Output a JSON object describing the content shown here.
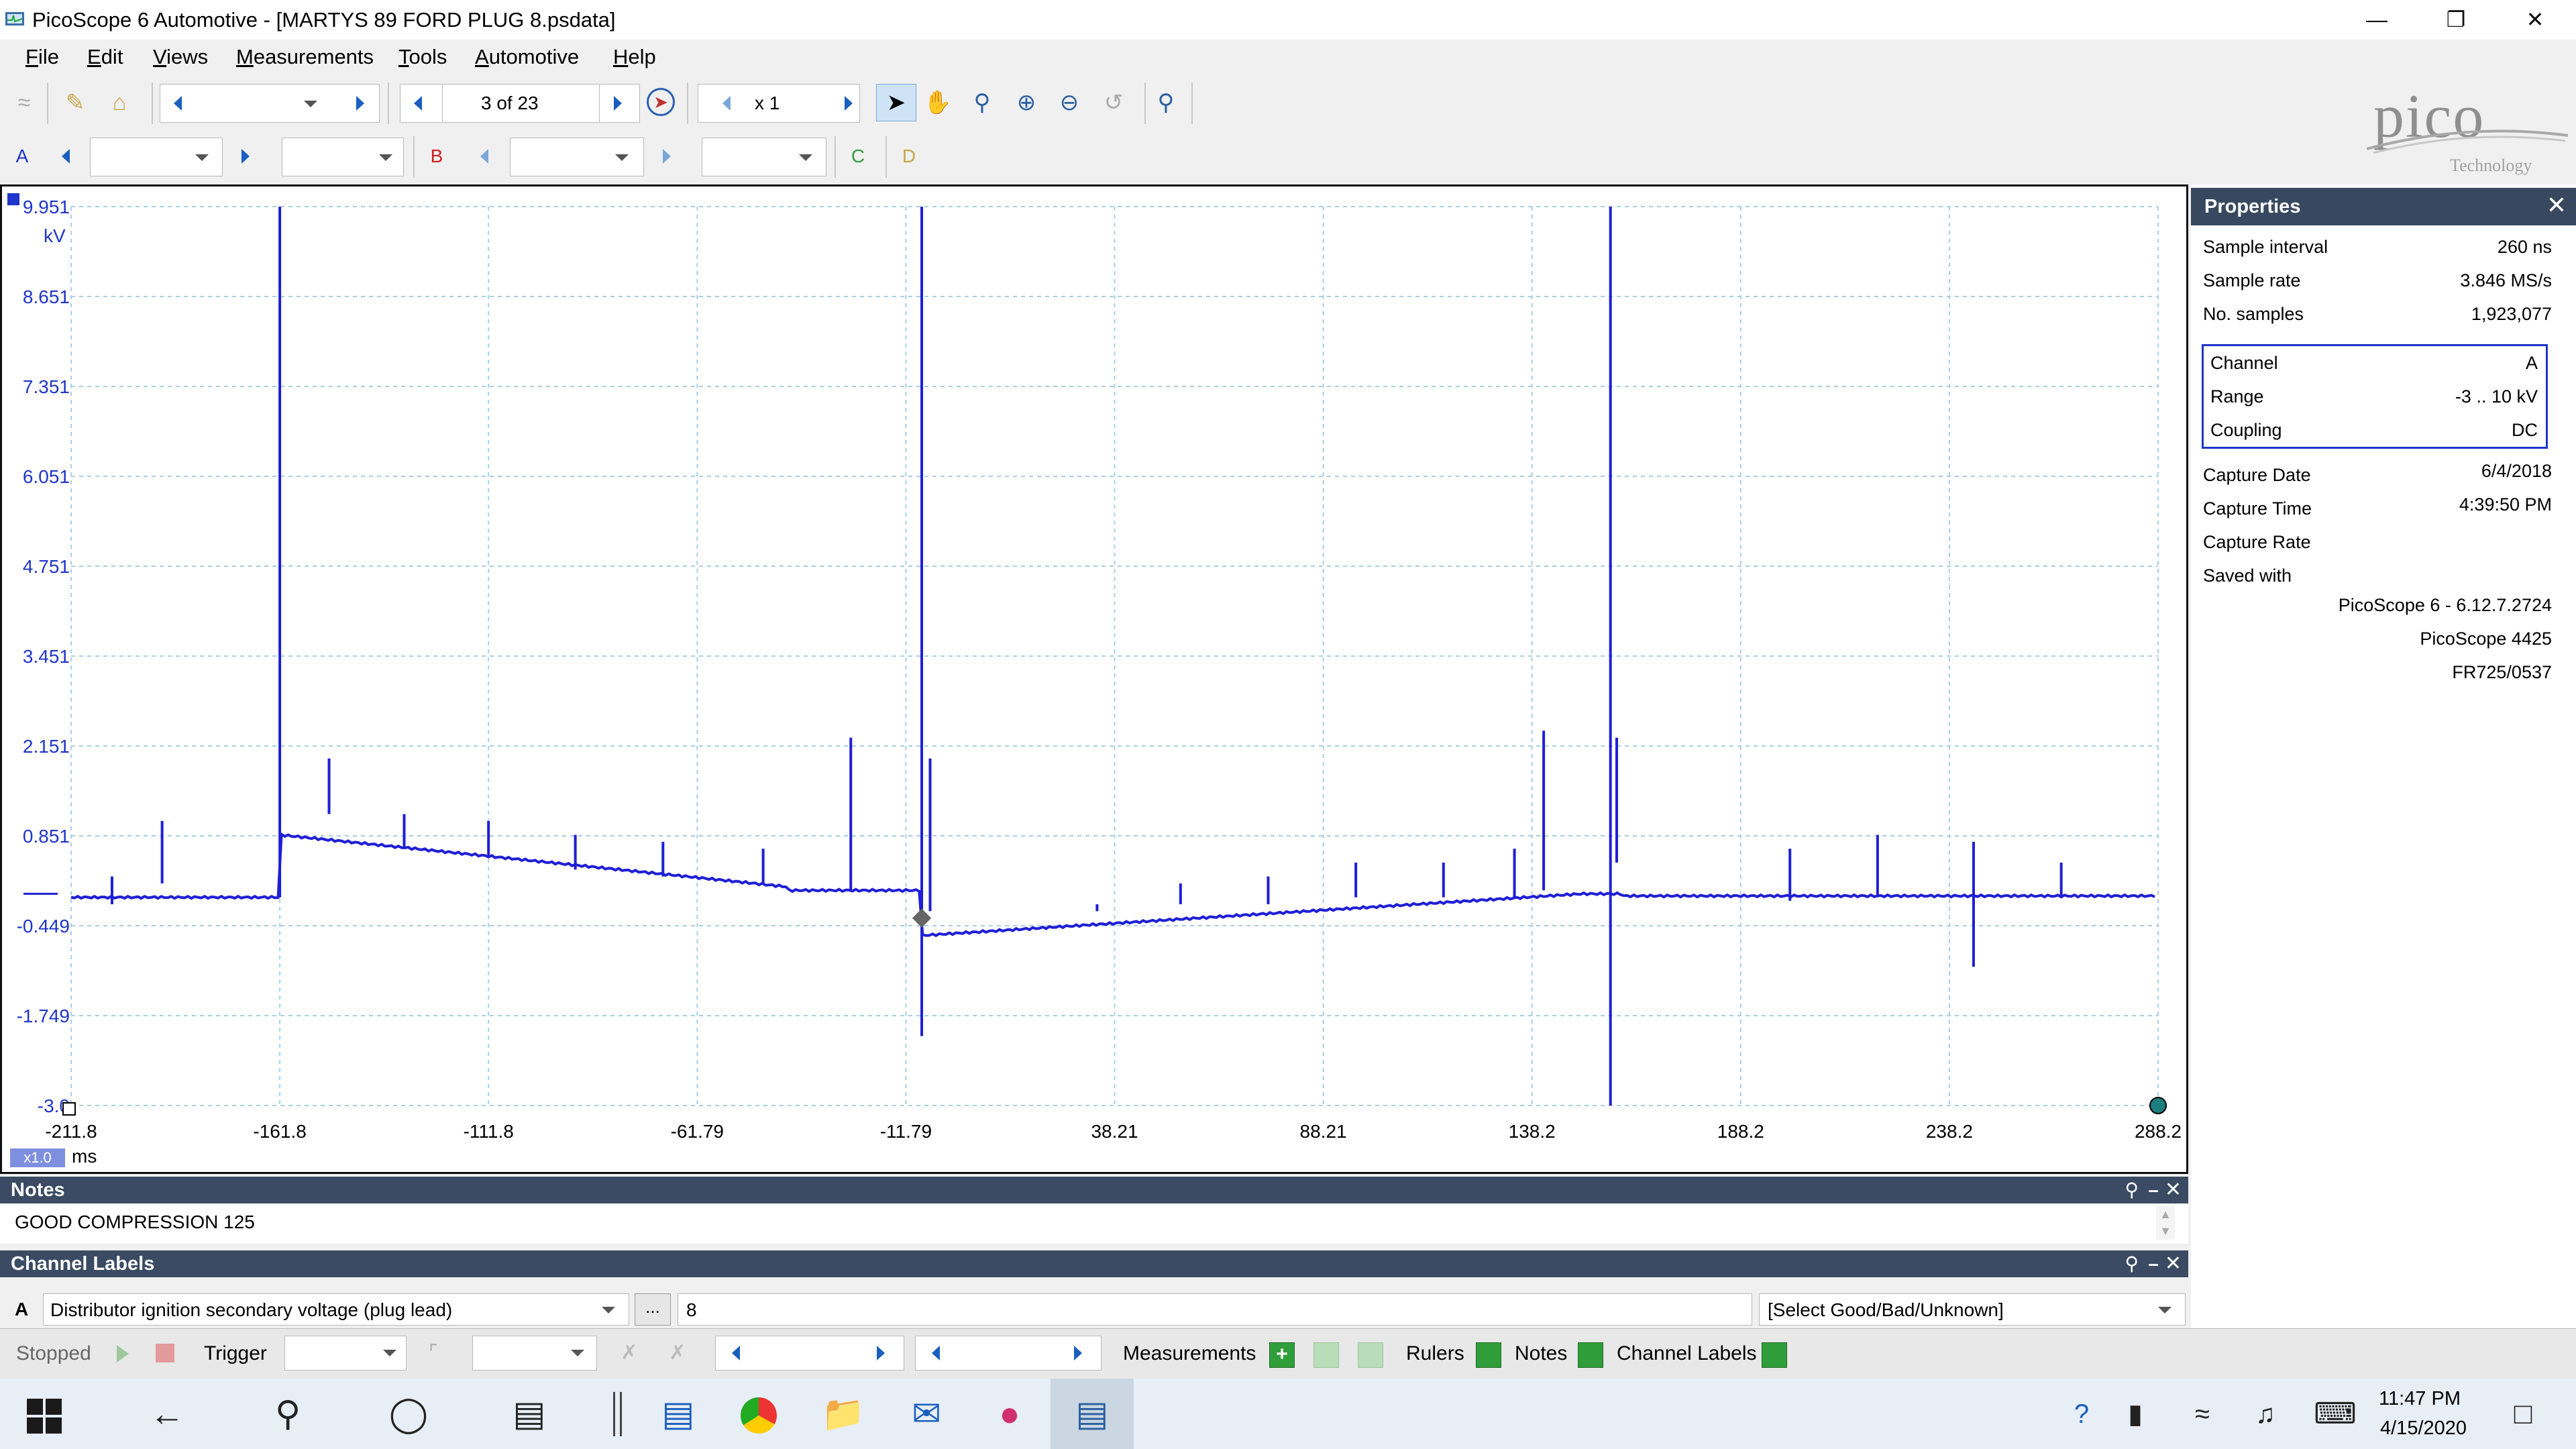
{
  "window": {
    "title": "PicoScope 6 Automotive - [MARTYS 89 FORD PLUG 8.psdata]"
  },
  "menu": [
    {
      "key": "F",
      "rest": "ile"
    },
    {
      "key": "E",
      "rest": "dit"
    },
    {
      "key": "V",
      "rest": "iews"
    },
    {
      "key": "M",
      "rest": "easurements"
    },
    {
      "key": "T",
      "rest": "ools"
    },
    {
      "key": "A",
      "rest": "utomotive"
    },
    {
      "key": "H",
      "rest": "elp"
    }
  ],
  "toolbar": {
    "page_indicator": "3 of 23",
    "zoom_value": "x 1"
  },
  "channels": {
    "a_button": "A",
    "b_button": "B",
    "c_button": "C",
    "d_button": "D"
  },
  "logo": {
    "name": "pico",
    "subtitle": "Technology"
  },
  "scope": {
    "y_axis_labels": [
      "9.951",
      "8.651",
      "7.351",
      "6.051",
      "4.751",
      "3.451",
      "2.151",
      "0.851",
      "-0.449",
      "-1.749",
      "-3.0"
    ],
    "y_unit": "kV",
    "x_axis_labels": [
      "-211.8",
      "-161.8",
      "-111.8",
      "-61.79",
      "-11.79",
      "38.21",
      "88.21",
      "138.2",
      "188.2",
      "238.2",
      "288.2"
    ],
    "x_unit": "ms",
    "zoom_badge": "x1.0",
    "trace_color": "#1f1fd6"
  },
  "properties": {
    "title": "Properties",
    "rows_top": [
      {
        "label": "Sample interval",
        "value": "260 ns"
      },
      {
        "label": "Sample rate",
        "value": "3.846 MS/s"
      },
      {
        "label": "No. samples",
        "value": "1,923,077"
      }
    ],
    "channel_rows": [
      {
        "label": "Channel",
        "value": "A"
      },
      {
        "label": "Range",
        "value": "-3 .. 10 kV"
      },
      {
        "label": "Coupling",
        "value": "DC"
      }
    ],
    "capture_rows": [
      {
        "label": "Capture Date",
        "value": "6/4/2018"
      },
      {
        "label": "Capture Time",
        "value": "4:39:50 PM"
      },
      {
        "label": "Capture Rate",
        "value": ""
      },
      {
        "label": "Saved with",
        "value": ""
      }
    ],
    "saved_with": [
      "PicoScope 6 - 6.12.7.2724",
      "PicoScope 4425",
      "FR725/0537"
    ]
  },
  "notes": {
    "header": "Notes",
    "text": "GOOD COMPRESSION 125"
  },
  "channel_labels": {
    "header": "Channel Labels",
    "channel": "A",
    "description": "Distributor ignition secondary voltage (plug lead)",
    "ellipsis": "...",
    "cylinder": "8",
    "rating": "[Select Good/Bad/Unknown]"
  },
  "statusbar": {
    "state": "Stopped",
    "trigger": "Trigger",
    "measurements": "Measurements",
    "rulers": "Rulers",
    "notes": "Notes",
    "channel_labels": "Channel Labels"
  },
  "taskbar": {
    "time": "11:47 PM",
    "date": "4/15/2020"
  }
}
